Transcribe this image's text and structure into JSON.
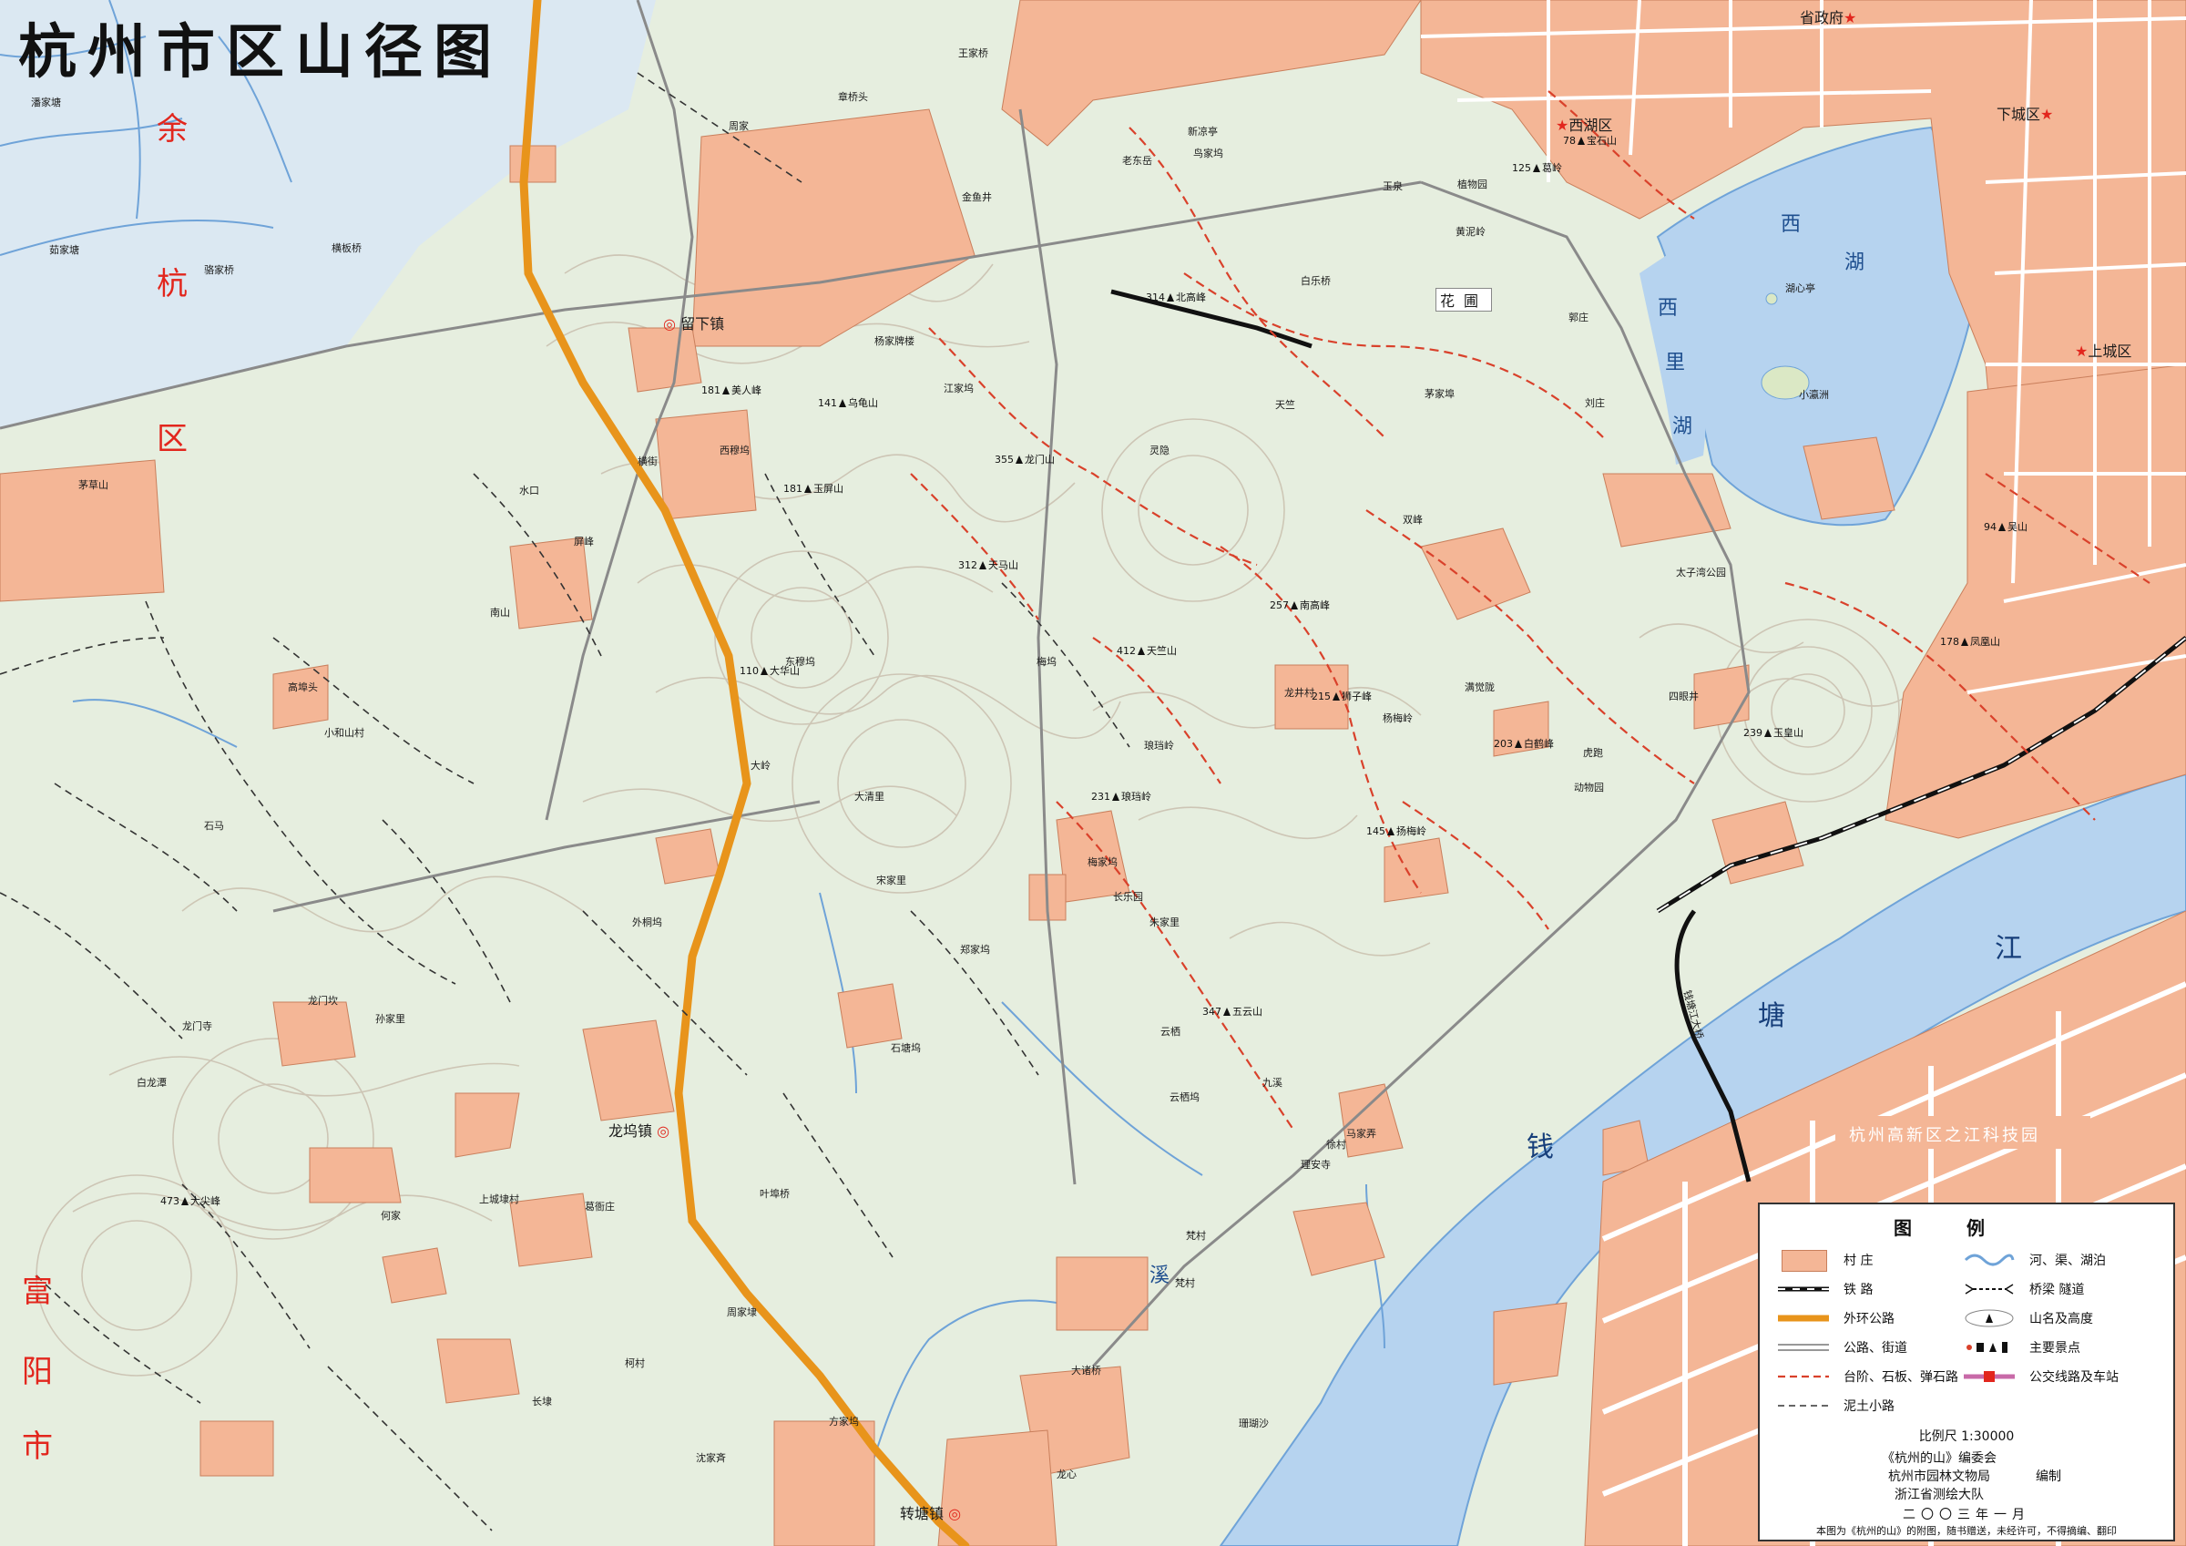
{
  "title": "杭州市区山径图",
  "districts": {
    "yuhang": [
      "余",
      "杭",
      "区"
    ],
    "fuyang": [
      "富",
      "阳",
      "市"
    ],
    "xihu": "西湖区",
    "xiacheng": "下城区",
    "shangcheng": "上城区",
    "shengzhengfu": "省政府"
  },
  "water_labels": {
    "west_lake": [
      "西",
      "湖"
    ],
    "xili_lake": [
      "西",
      "里",
      "湖"
    ],
    "huxin_ting": "湖心亭",
    "xiaoyingzhou": "小瀛洲",
    "qiantang_river": [
      "钱",
      "塘",
      "江"
    ],
    "xi_stream": [
      "溪"
    ]
  },
  "zone_label": "杭州高新区之江科技园",
  "towns": {
    "liuxia": "留下镇",
    "longwu": "龙坞镇",
    "zhuantang": "转塘镇",
    "tiantang_bridge": "钱塘江大桥"
  },
  "places": [
    "潘家塘",
    "茹家塘",
    "骆家桥",
    "横板桥",
    "王家桥",
    "章桥头",
    "周家",
    "茅草山",
    "横街",
    "水口",
    "屏峰",
    "南山",
    "高埠头",
    "小和山村",
    "石马",
    "龙门坎",
    "龙门寺",
    "白龙潭",
    "孙家里",
    "何家",
    "上城埭村",
    "葛衙庄",
    "叶埠桥",
    "周家埭",
    "柯村",
    "长埭",
    "方家坞",
    "沈家斉",
    "龙心",
    "大诸桥",
    "珊瑚沙",
    "梵村",
    "徐村",
    "云栖",
    "梅家坞",
    "郑家坞",
    "宋家里",
    "外桐坞",
    "石塘坞",
    "东穆坞",
    "西穆坞",
    "杨家牌楼",
    "江家坞",
    "大岭",
    "大清里",
    "长乐园",
    "朱家里",
    "琅珰岭",
    "灵隐",
    "天竺",
    "龙井村",
    "双峰",
    "满觉陇",
    "四眼井",
    "动物园",
    "虎跑",
    "玉泉",
    "黄泥岭",
    "植物园",
    "新凉亭",
    "老东岳",
    "白乐桥",
    "茅家埠",
    "刘庄",
    "郭庄",
    "金鱼井",
    "梅坞",
    "梵村",
    "鸟家坞",
    "马家弄",
    "云栖坞",
    "九溪",
    "理安寺",
    "杨梅岭",
    "太子湾公园",
    "花圃"
  ],
  "peaks": [
    {
      "name": "美人峰",
      "h": "181"
    },
    {
      "name": "玉屏山",
      "h": "181"
    },
    {
      "name": "北高峰",
      "h": "314"
    },
    {
      "name": "天马山",
      "h": "312"
    },
    {
      "name": "龙门山",
      "h": "355"
    },
    {
      "name": "乌龟山",
      "h": "141"
    },
    {
      "name": "南高峰",
      "h": "257"
    },
    {
      "name": "玉皇山",
      "h": "239"
    },
    {
      "name": "凤凰山",
      "h": "178"
    },
    {
      "name": "吴山",
      "h": "94"
    },
    {
      "name": "宝石山",
      "h": "78"
    },
    {
      "name": "葛岭",
      "h": "125"
    },
    {
      "name": "五云山",
      "h": "347"
    },
    {
      "name": "天竺山",
      "h": "412"
    },
    {
      "name": "大华山",
      "h": "110"
    },
    {
      "name": "大尖峰",
      "h": "473"
    },
    {
      "name": "狮子峰",
      "h": "215"
    },
    {
      "name": "白鹤峰",
      "h": "203"
    },
    {
      "name": "琅珰岭",
      "h": "231"
    },
    {
      "name": "扬梅岭",
      "h": "145"
    }
  ],
  "legend": {
    "title": "图例",
    "items": [
      {
        "label": "村 庄",
        "key": "village"
      },
      {
        "label": "河、渠、湖泊",
        "key": "water"
      },
      {
        "label": "铁  路",
        "key": "rail"
      },
      {
        "label": "桥梁 隧道",
        "key": "bridge"
      },
      {
        "label": "外环公路",
        "key": "ring"
      },
      {
        "label": "山名及高度",
        "key": "peak"
      },
      {
        "label": "公路、街道",
        "key": "road"
      },
      {
        "label": "主要景点",
        "key": "scenic"
      },
      {
        "label": "台阶、石板、弹石路",
        "key": "stone"
      },
      {
        "label": "公交线路及车站",
        "key": "bus"
      },
      {
        "label": "泥土小路",
        "key": "dirt"
      }
    ],
    "scale": "比例尺 1:30000",
    "editor": "《杭州的山》编委会",
    "bureau": "杭州市园林文物局",
    "role": "编制",
    "survey": "浙江省测绘大队",
    "date": "二〇〇三年一月",
    "note": "本图为《杭州的山》的附图，随书赠送，未经许可，不得摘编、翻印"
  },
  "colors": {
    "land": "#e6eedf",
    "village": "#f4b696",
    "water": "#b6d3ef",
    "river_dark": "#6fa3d8",
    "ring_road": "#e8941b",
    "red_text": "#e2261d",
    "contour": "#c9bfae",
    "red_path": "#d9412b"
  }
}
